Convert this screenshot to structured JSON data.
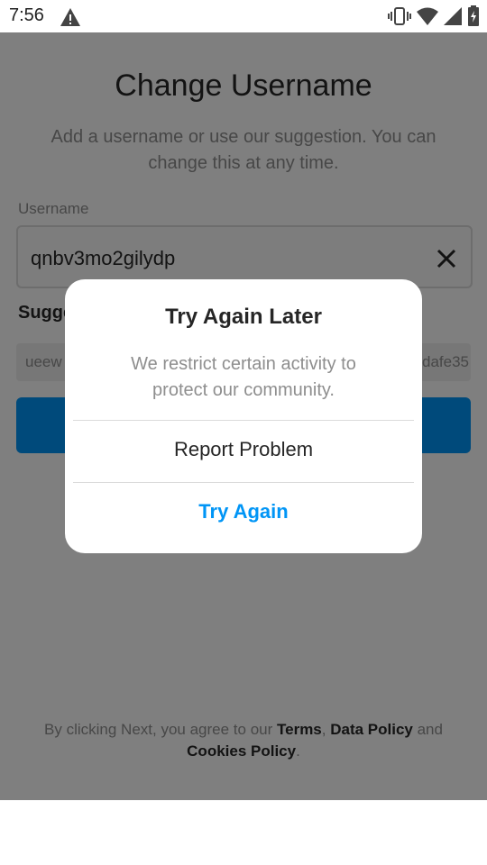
{
  "status_bar": {
    "time": "7:56",
    "icons": [
      "warning-icon",
      "vibrate-icon",
      "wifi-icon",
      "signal-icon",
      "battery-icon"
    ]
  },
  "screen": {
    "title": "Change Username",
    "subtitle": "Add a username or use our suggestion. You can change this at any time.",
    "field_label": "Username",
    "username_value": "qnbv3mo2gilydp",
    "suggestions_label": "Sugge",
    "suggestions": [
      "ueew",
      "dafe35"
    ],
    "footer": {
      "prefix": "By clicking Next, you agree to our ",
      "terms": "Terms",
      "sep": ", ",
      "data_policy": "Data Policy",
      "and": " and ",
      "cookies_policy": "Cookies Policy",
      "end": "."
    }
  },
  "dialog": {
    "title": "Try Again Later",
    "body": "We restrict certain activity to protect our community.",
    "report_label": "Report Problem",
    "retry_label": "Try Again"
  },
  "colors": {
    "accent": "#0095f6",
    "overlay": "rgba(0,0,0,0.5)"
  }
}
